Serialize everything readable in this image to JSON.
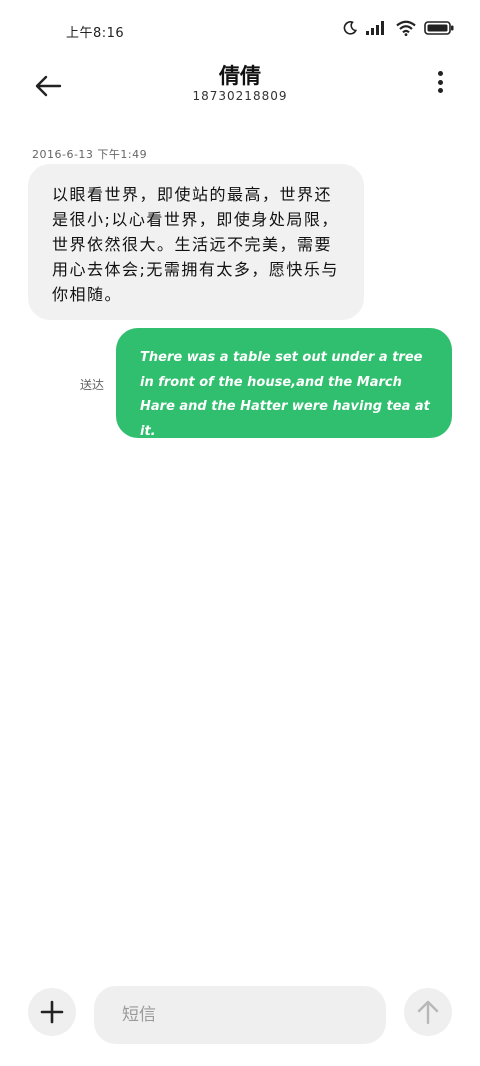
{
  "status_bar": {
    "time": "上午8:16",
    "icons": [
      "moon-icon",
      "signal-icon",
      "wifi-icon",
      "battery-icon"
    ]
  },
  "header": {
    "contact_name": "倩倩",
    "contact_phone": "18730218809",
    "icons": [
      "back-arrow-icon",
      "more-vertical-icon"
    ]
  },
  "conversation": {
    "timestamp": "2016-6-13 下午1:49",
    "received_message": "以眼看世界，即使站的最高，世界还是很小;以心看世界，即使身处局限，世界依然很大。生活远不完美，需要用心去体会;无需拥有太多，愿快乐与你相随。",
    "sent_message": "There was a table set out under a tree in front of the house,and the March Hare and the Hatter were having tea at it.",
    "sent_status": "送达"
  },
  "composer": {
    "placeholder": "短信",
    "icons": [
      "plus-icon",
      "send-arrow-icon"
    ]
  },
  "colors": {
    "sent_bubble": "#30bf6e",
    "received_bubble": "#f1f1f1",
    "background": "#ffffff"
  }
}
